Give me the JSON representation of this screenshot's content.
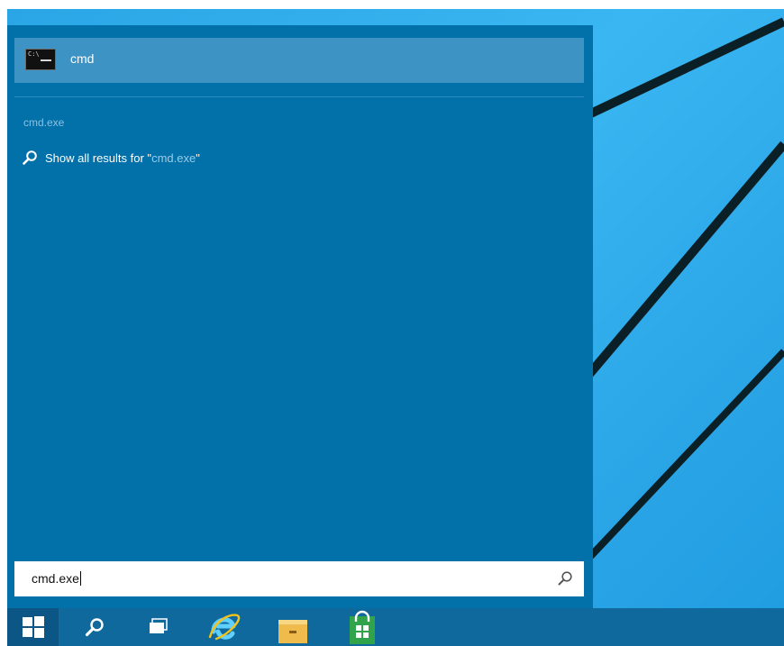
{
  "search_panel": {
    "top_result": {
      "label": "cmd",
      "icon": "command-prompt-icon"
    },
    "section": {
      "label": "cmd.exe"
    },
    "show_all": {
      "prefix": "Show all results for \"",
      "query": "cmd.exe",
      "suffix": "\"",
      "icon": "search-icon"
    }
  },
  "search_box": {
    "value": "cmd.exe",
    "icon": "search-icon"
  },
  "taskbar": {
    "items": [
      {
        "name": "start-button",
        "icon": "windows-logo-icon"
      },
      {
        "name": "search-button",
        "icon": "search-icon"
      },
      {
        "name": "task-view-button",
        "icon": "task-view-icon"
      },
      {
        "name": "internet-explorer-button",
        "icon": "internet-explorer-icon"
      },
      {
        "name": "file-explorer-button",
        "icon": "folder-icon"
      },
      {
        "name": "store-button",
        "icon": "store-icon"
      }
    ]
  },
  "colors": {
    "panel": "#0271aa",
    "highlight": "#3c93c4",
    "taskbar": "#0f699c",
    "wallpaper": "#2aa6e6"
  }
}
